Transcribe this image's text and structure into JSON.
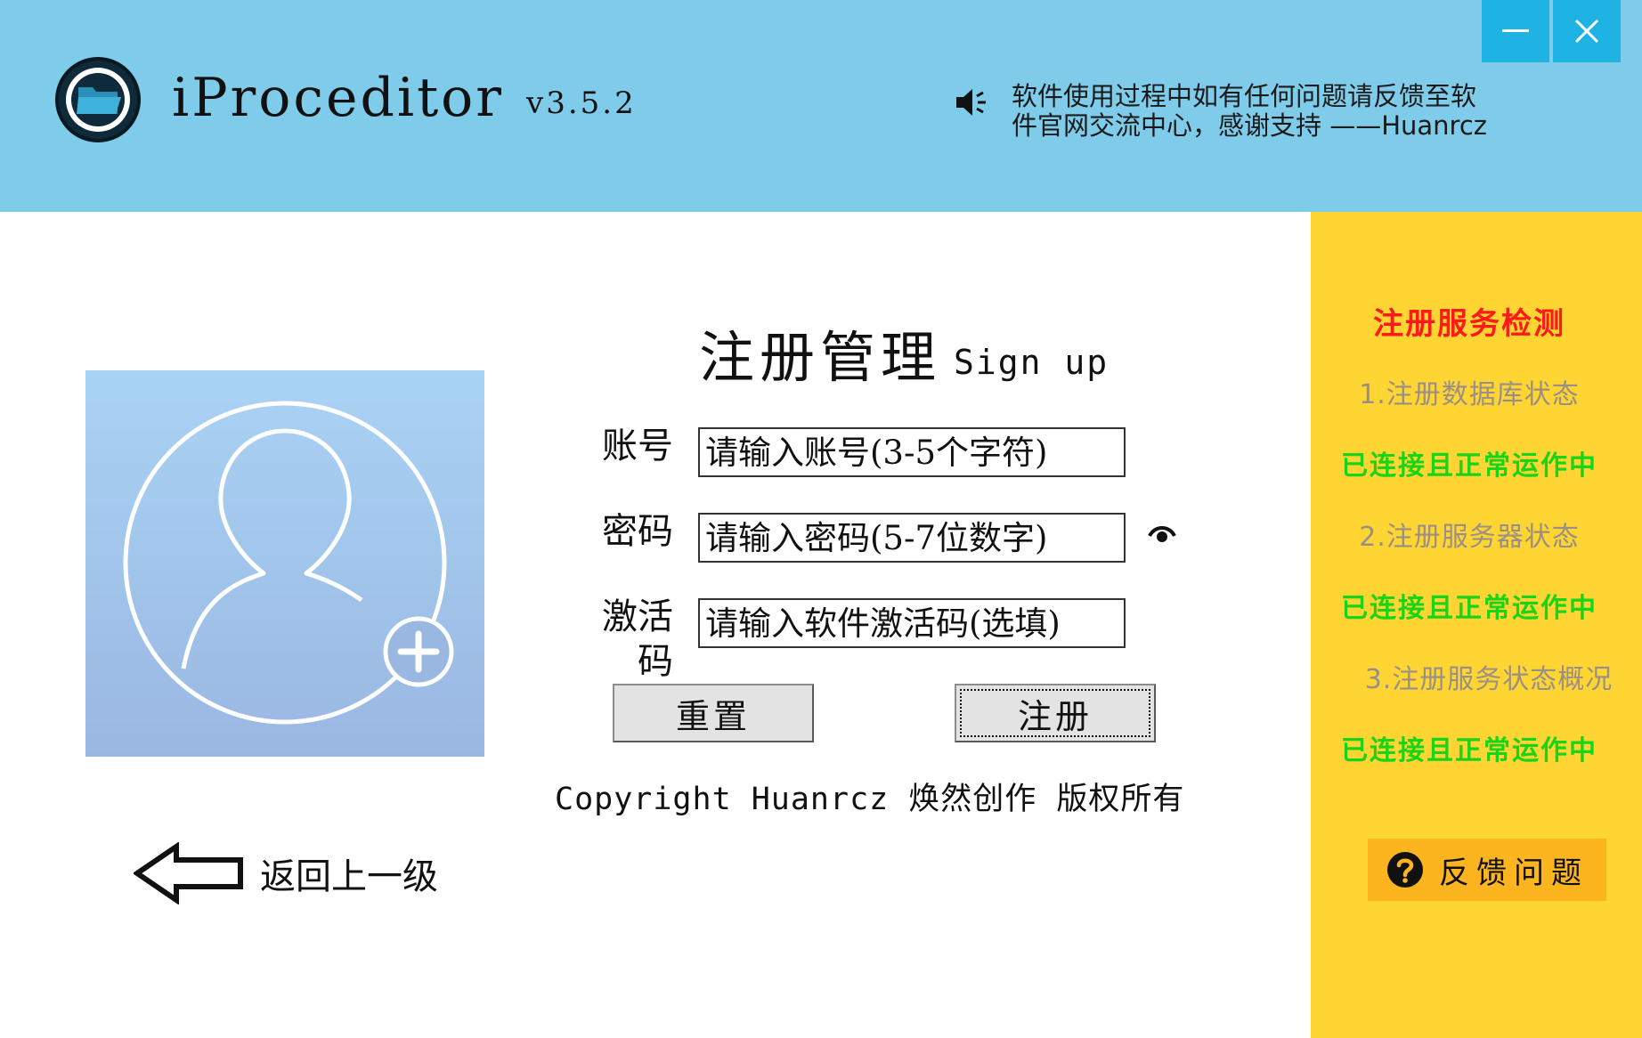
{
  "window": {
    "minimize_label": "—",
    "close_label": "✕"
  },
  "header": {
    "app_name": "iProceditor",
    "version": "v3.5.2",
    "logo_icon": "folder-icon",
    "notice_icon": "speaker-icon",
    "notice_line1": "软件使用过程中如有任何问题请反馈至软",
    "notice_line2": "件官网交流中心，感谢支持 ——Huanrcz",
    "background_color": "#7ecbea",
    "window_button_color": "#1fb3e4"
  },
  "form": {
    "title": "注册管理",
    "subtitle": "Sign up",
    "avatar_icon": "add-user-icon",
    "account": {
      "label": "账号",
      "placeholder": "请输入账号(3-5个字符)"
    },
    "password": {
      "label": "密码",
      "placeholder": "请输入密码(5-7位数字)",
      "toggle_icon": "eye-icon"
    },
    "activation": {
      "label": "激活码",
      "placeholder": "请输入软件激活码(选填)"
    },
    "reset_label": "重置",
    "submit_label": "注册",
    "copyright": "Copyright Huanrcz 焕然创作 版权所有"
  },
  "back": {
    "label": "返回上一级",
    "icon": "arrow-left-icon"
  },
  "side_panel": {
    "title": "注册服务检测",
    "background_color": "#fed532",
    "checks": [
      {
        "label": "1.注册数据库状态",
        "status": "已连接且正常运作中"
      },
      {
        "label": "2.注册服务器状态",
        "status": "已连接且正常运作中"
      },
      {
        "label": "3.注册服务状态概况",
        "status": "已连接且正常运作中"
      }
    ],
    "status_color": "#19d419",
    "feedback_label": "反馈问题",
    "feedback_icon": "help-icon"
  }
}
